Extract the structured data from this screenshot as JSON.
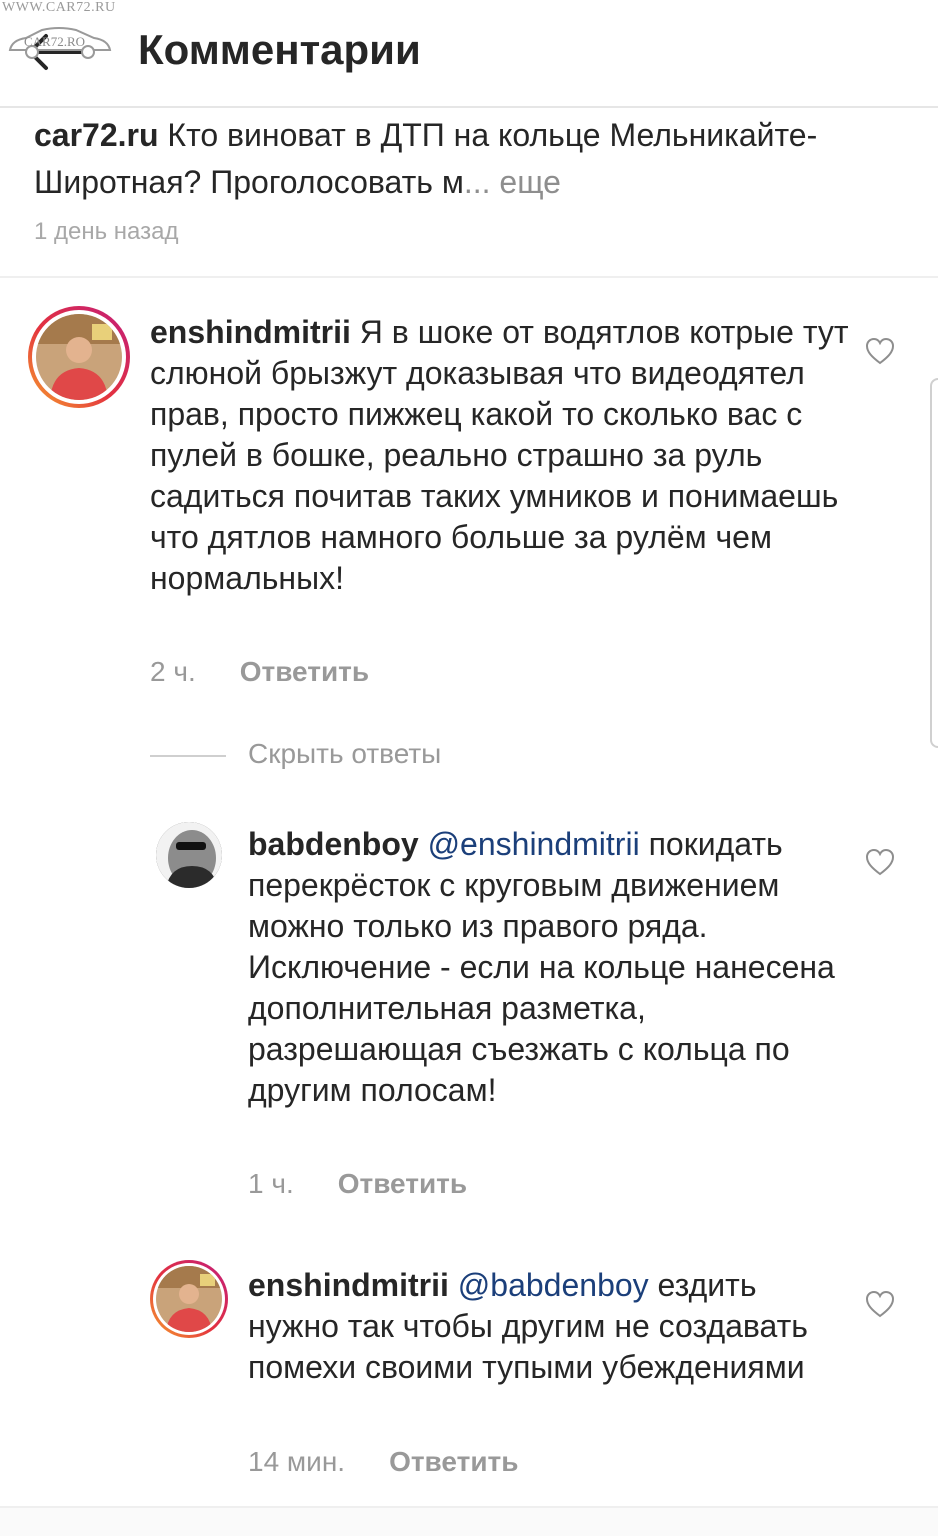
{
  "watermark": {
    "url": "WWW.CAR72.RU",
    "logo_text": "CAR72.RO"
  },
  "header": {
    "title": "Комментарии",
    "back_icon": "arrow-left-icon"
  },
  "caption": {
    "username": "car72.ru",
    "text": "Кто виноват в ДТП на кольце Мельникайте-Широтная? Проголосовать м",
    "ellipsis": "...",
    "more_label": "еще",
    "time": "1 день назад"
  },
  "comments": [
    {
      "username": "enshindmitrii",
      "text": "Я в шоке от  водятлов котрые тут слюной брызжут доказывая что видеодятел прав, просто пижжец какой то сколько вас с пулей в бошке, реально страшно за руль садиться почитав таких умников и понимаешь что дятлов намного больше за рулём чем нормальных!",
      "time": "2 ч.",
      "reply_label": "Ответить"
    }
  ],
  "hide_replies_label": "Скрыть ответы",
  "replies": [
    {
      "username": "babdenboy",
      "mention": "@enshindmitrii",
      "text": "покидать перекрёсток с круговым движением можно только из правого ряда. Исключение - если на кольце нанесена дополнительная разметка, разрешающая съезжать с кольца по другим полосам!",
      "time": "1 ч.",
      "reply_label": "Ответить"
    },
    {
      "username": "enshindmitrii",
      "mention": "@babdenboy",
      "text": "ездить нужно так чтобы другим не создавать помехи своими тупыми убеждениями",
      "time": "14 мин.",
      "reply_label": "Ответить"
    }
  ],
  "colors": {
    "text": "#262626",
    "muted": "#999999",
    "mention": "#1b3f7a",
    "story_ring_start": "#f7a22e",
    "story_ring_end": "#c21d7b"
  },
  "icons": {
    "like": "heart-outline-icon"
  }
}
